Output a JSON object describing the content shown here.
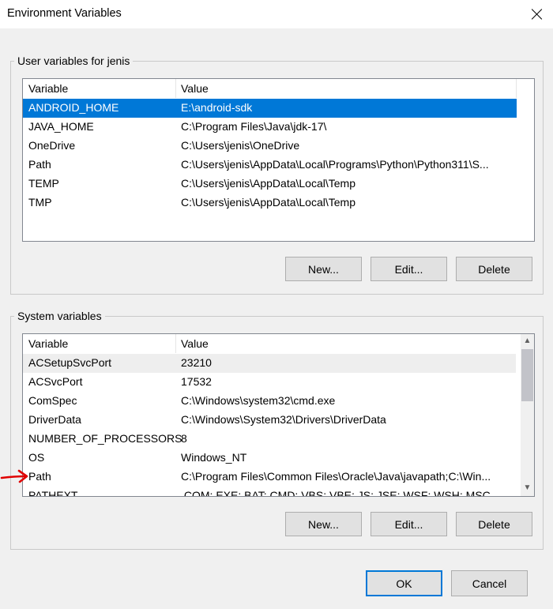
{
  "window": {
    "title": "Environment Variables"
  },
  "user_section": {
    "label": "User variables for jenis",
    "columns": [
      "Variable",
      "Value"
    ],
    "rows": [
      {
        "name": "ANDROID_HOME",
        "value": "E:\\android-sdk",
        "selected": true
      },
      {
        "name": "JAVA_HOME",
        "value": "C:\\Program Files\\Java\\jdk-17\\"
      },
      {
        "name": "OneDrive",
        "value": "C:\\Users\\jenis\\OneDrive"
      },
      {
        "name": "Path",
        "value": "C:\\Users\\jenis\\AppData\\Local\\Programs\\Python\\Python311\\S..."
      },
      {
        "name": "TEMP",
        "value": "C:\\Users\\jenis\\AppData\\Local\\Temp"
      },
      {
        "name": "TMP",
        "value": "C:\\Users\\jenis\\AppData\\Local\\Temp"
      }
    ],
    "buttons": {
      "new": "New...",
      "edit": "Edit...",
      "delete": "Delete"
    }
  },
  "system_section": {
    "label": "System variables",
    "columns": [
      "Variable",
      "Value"
    ],
    "rows": [
      {
        "name": "ACSetupSvcPort",
        "value": "23210"
      },
      {
        "name": "ACSvcPort",
        "value": "17532"
      },
      {
        "name": "ComSpec",
        "value": "C:\\Windows\\system32\\cmd.exe"
      },
      {
        "name": "DriverData",
        "value": "C:\\Windows\\System32\\Drivers\\DriverData"
      },
      {
        "name": "NUMBER_OF_PROCESSORS",
        "value": "8"
      },
      {
        "name": "OS",
        "value": "Windows_NT"
      },
      {
        "name": "Path",
        "value": "C:\\Program Files\\Common Files\\Oracle\\Java\\javapath;C:\\Win..."
      },
      {
        "name": "PATHEXT",
        "value": ".COM;.EXE;.BAT;.CMD;.VBS;.VBE;.JS;.JSE;.WSF;.WSH;.MSC"
      }
    ],
    "buttons": {
      "new": "New...",
      "edit": "Edit...",
      "delete": "Delete"
    }
  },
  "footer": {
    "ok": "OK",
    "cancel": "Cancel"
  },
  "colors": {
    "selection": "#0078d7",
    "annotation_arrow": "#e00000"
  }
}
